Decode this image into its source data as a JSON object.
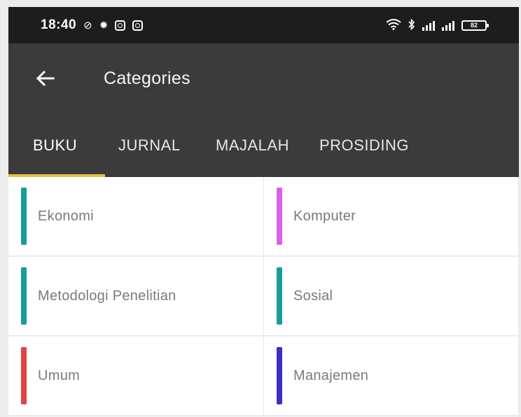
{
  "status_bar": {
    "time": "18:40",
    "left_icons": [
      "no-alarm-icon",
      "gear-icon",
      "instagram-icon",
      "instagram-icon"
    ],
    "right_icons": [
      "wifi-icon",
      "bluetooth-icon",
      "signal-icon",
      "signal-icon",
      "battery-icon"
    ],
    "battery": "82"
  },
  "app_bar": {
    "title": "Categories",
    "back_icon": "arrow-left-icon"
  },
  "tabs": [
    {
      "label": "BUKU",
      "active": true
    },
    {
      "label": "JURNAL",
      "active": false
    },
    {
      "label": "MAJALAH",
      "active": false
    },
    {
      "label": "PROSIDING",
      "active": false
    }
  ],
  "tab_indicator_color": "#e7c23a",
  "categories": [
    {
      "label": "Ekonomi",
      "color": "#1a9c9c"
    },
    {
      "label": "Komputer",
      "color": "#d862e8"
    },
    {
      "label": "Metodologi Penelitian",
      "color": "#1a9c9c"
    },
    {
      "label": "Sosial",
      "color": "#1a9c9c"
    },
    {
      "label": "Umum",
      "color": "#e14444"
    },
    {
      "label": "Manajemen",
      "color": "#3d2ec7"
    }
  ]
}
